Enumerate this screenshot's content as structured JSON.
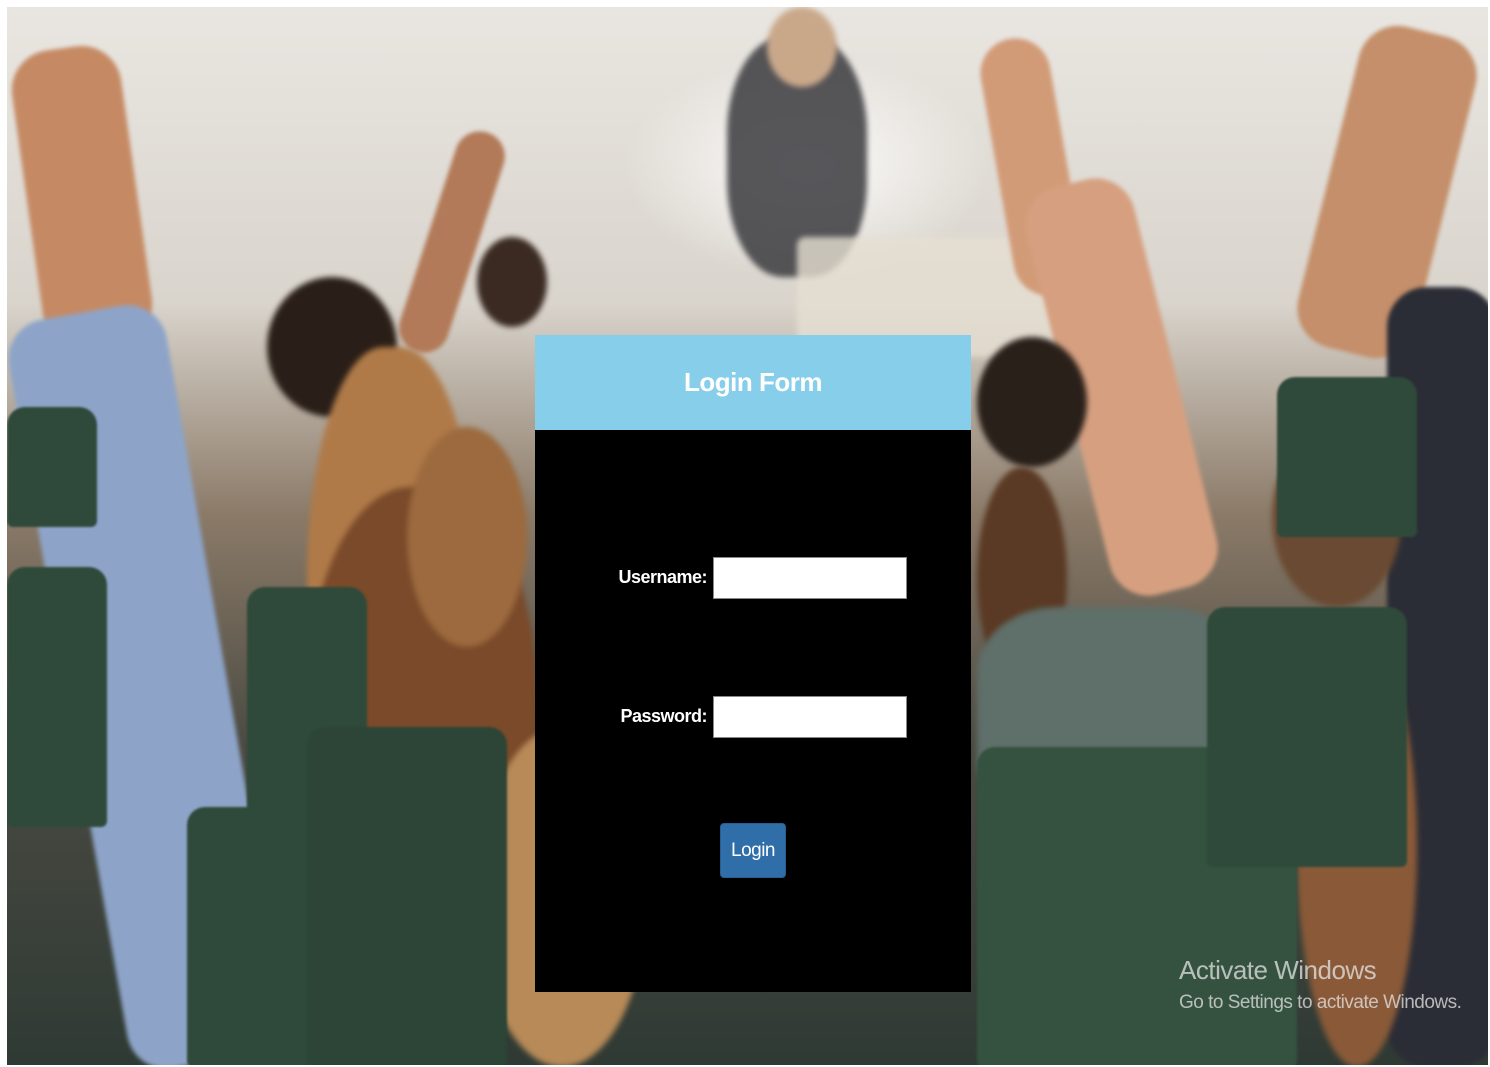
{
  "login_form": {
    "title": "Login Form",
    "username_label": "Username:",
    "username_value": "",
    "password_label": "Password:",
    "password_value": "",
    "login_button_label": "Login"
  },
  "watermark": {
    "title": "Activate Windows",
    "subtitle": "Go to Settings to activate Windows."
  },
  "colors": {
    "header": "#87ceeb",
    "panel": "#000000",
    "button": "#2f6ea8"
  }
}
